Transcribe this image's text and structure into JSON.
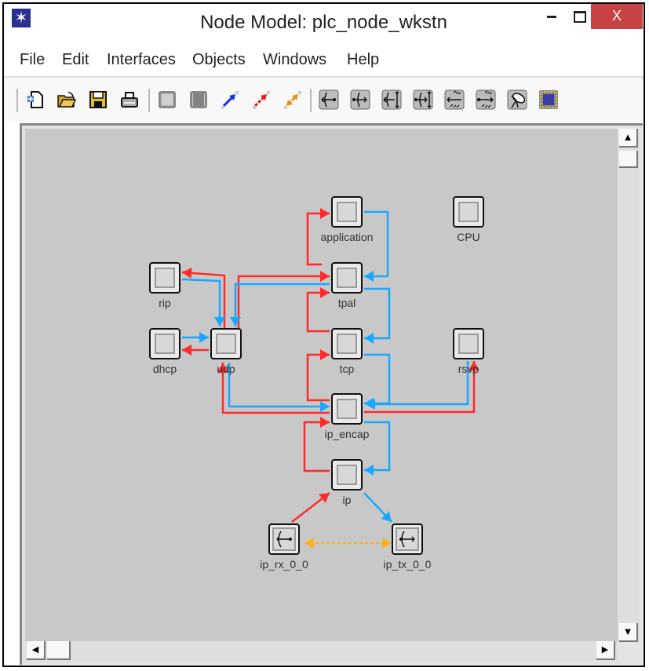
{
  "window": {
    "title": "Node Model: plc_node_wkstn",
    "app_icon": "opnet-star-icon",
    "controls": {
      "minimize": "minimize",
      "maximize": "maximize",
      "close": "X"
    }
  },
  "menu": [
    "File",
    "Edit",
    "Interfaces",
    "Objects",
    "Windows",
    "Help"
  ],
  "toolbar": {
    "groups": [
      [
        "new-file-icon",
        "open-folder-icon",
        "save-icon",
        "print-icon"
      ],
      [
        "create-processor-icon",
        "create-queue-icon",
        "packet-stream-icon",
        "statistic-wire-icon",
        "logical-association-icon"
      ],
      [
        "point-to-point-receiver-icon",
        "point-to-point-transmitter-icon",
        "bus-receiver-icon",
        "bus-transmitter-icon",
        "radio-receiver-icon",
        "radio-transmitter-icon",
        "antenna-icon",
        "external-system-icon"
      ]
    ]
  },
  "nodes": [
    {
      "id": "application",
      "label": "application",
      "type": "processor"
    },
    {
      "id": "tpal",
      "label": "tpal",
      "type": "processor"
    },
    {
      "id": "tcp",
      "label": "tcp",
      "type": "processor"
    },
    {
      "id": "ip_encap",
      "label": "ip_encap",
      "type": "processor"
    },
    {
      "id": "ip",
      "label": "ip",
      "type": "processor"
    },
    {
      "id": "CPU",
      "label": "CPU",
      "type": "processor"
    },
    {
      "id": "rsvp",
      "label": "rsvp",
      "type": "processor"
    },
    {
      "id": "rip",
      "label": "rip",
      "type": "processor"
    },
    {
      "id": "dhcp",
      "label": "dhcp",
      "type": "processor"
    },
    {
      "id": "udp",
      "label": "udp",
      "type": "processor"
    },
    {
      "id": "ip_rx_0_0",
      "label": "ip_rx_0_0",
      "type": "receiver"
    },
    {
      "id": "ip_tx_0_0",
      "label": "ip_tx_0_0",
      "type": "transmitter"
    }
  ],
  "links": [
    {
      "from": "tpal",
      "to": "application",
      "color": "red"
    },
    {
      "from": "application",
      "to": "tpal",
      "color": "blue"
    },
    {
      "from": "tcp",
      "to": "tpal",
      "color": "red"
    },
    {
      "from": "tpal",
      "to": "tcp",
      "color": "blue"
    },
    {
      "from": "ip_encap",
      "to": "tcp",
      "color": "red"
    },
    {
      "from": "tcp",
      "to": "ip_encap",
      "color": "blue"
    },
    {
      "from": "ip",
      "to": "ip_encap",
      "color": "red"
    },
    {
      "from": "ip_encap",
      "to": "ip",
      "color": "blue"
    },
    {
      "from": "udp",
      "to": "tpal",
      "color": "red"
    },
    {
      "from": "tpal",
      "to": "udp",
      "color": "blue"
    },
    {
      "from": "udp",
      "to": "rip",
      "color": "red"
    },
    {
      "from": "rip",
      "to": "udp",
      "color": "blue"
    },
    {
      "from": "udp",
      "to": "dhcp",
      "color": "red"
    },
    {
      "from": "dhcp",
      "to": "udp",
      "color": "blue"
    },
    {
      "from": "ip_encap",
      "to": "udp",
      "color": "red"
    },
    {
      "from": "udp",
      "to": "ip_encap",
      "color": "blue"
    },
    {
      "from": "ip_encap",
      "to": "rsvp",
      "color": "red"
    },
    {
      "from": "rsvp",
      "to": "ip_encap",
      "color": "blue"
    },
    {
      "from": "ip_rx_0_0",
      "to": "ip",
      "color": "red"
    },
    {
      "from": "ip",
      "to": "ip_tx_0_0",
      "color": "blue"
    },
    {
      "from": "ip_rx_0_0",
      "to": "ip_tx_0_0",
      "color": "orange",
      "style": "dashed",
      "bidirectional": true
    }
  ],
  "colors": {
    "packet_stream_red": "#ff2a2a",
    "statistic_blue": "#1aa8ff",
    "association_orange": "#ffb020",
    "canvas_bg": "#c8c8c8",
    "close_button": "#c74242"
  },
  "scrollbars": {
    "vertical": {
      "up": "▲",
      "down": "▼"
    },
    "horizontal": {
      "left": "◀",
      "right": "▶"
    }
  }
}
